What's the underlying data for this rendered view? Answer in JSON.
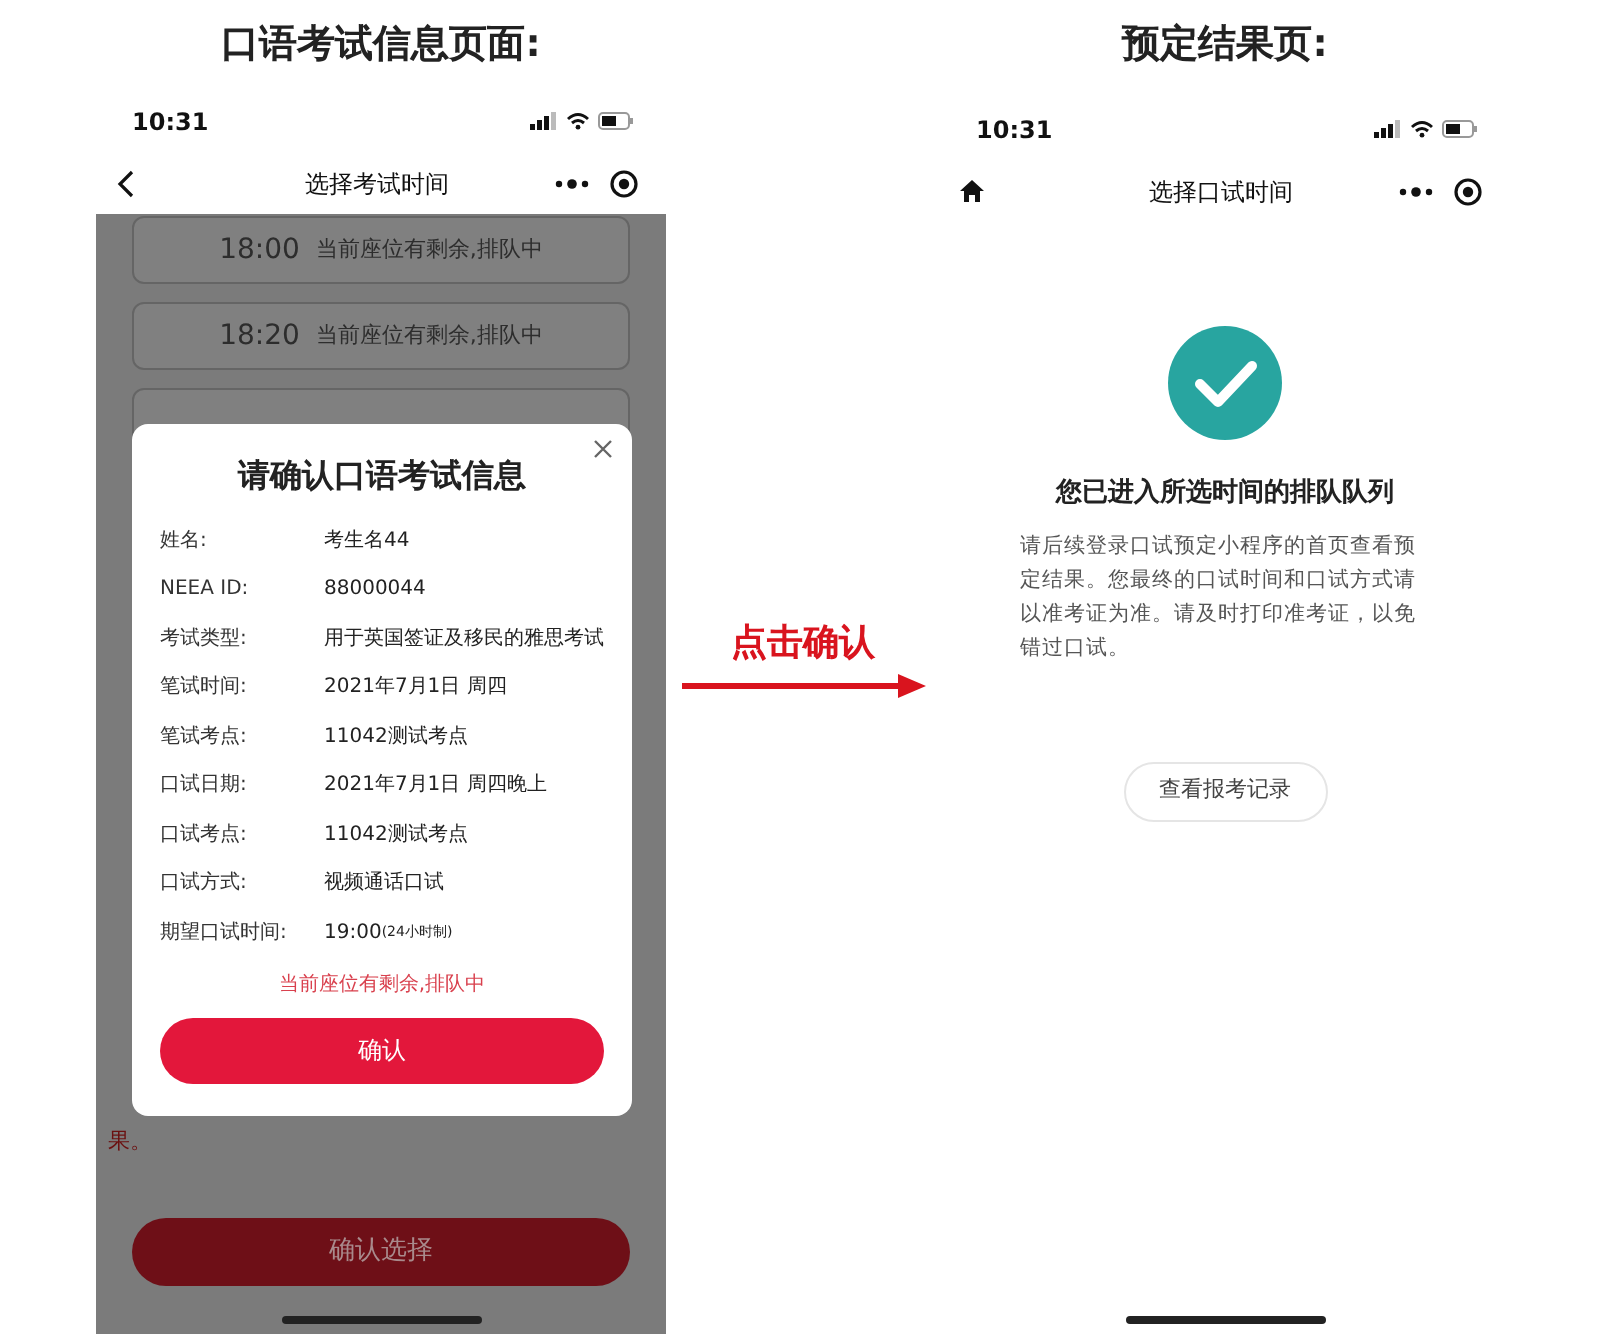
{
  "left_title": "口语考试信息页面:",
  "right_title": "预定结果页:",
  "arrow_label": "点击确认",
  "left_screen": {
    "status_time": "10:31",
    "nav_title": "选择考试时间",
    "slots": [
      {
        "time": "18:00",
        "status": "当前座位有剩余,排队中"
      },
      {
        "time": "18:20",
        "status": "当前座位有剩余,排队中"
      }
    ],
    "background_note": "果。",
    "footer_button": "确认选择",
    "dialog": {
      "title": "请确认口语考试信息",
      "fields": [
        {
          "label": "姓名:",
          "value": "考生名44"
        },
        {
          "label": "NEEA ID:",
          "value": "88000044"
        },
        {
          "label": "考试类型:",
          "value": "用于英国签证及移民的雅思考试"
        },
        {
          "label": "笔试时间:",
          "value": "2021年7月1日 周四"
        },
        {
          "label": "笔试考点:",
          "value": "11042测试考点"
        },
        {
          "label": "口试日期:",
          "value": "2021年7月1日 周四晚上"
        },
        {
          "label": "口试考点:",
          "value": "11042测试考点"
        },
        {
          "label": "口试方式:",
          "value": "视频通话口试"
        },
        {
          "label": "期望口试时间:",
          "value": "19:00",
          "note": "(24小时制)"
        }
      ],
      "status_note": "当前座位有剩余,排队中",
      "confirm_button": "确认"
    }
  },
  "right_screen": {
    "status_time": "10:31",
    "nav_title": "选择口试时间",
    "heading": "您已进入所选时间的排队队列",
    "body": "请后续登录口试预定小程序的首页查看预定结果。您最终的口试时间和口试方式请以准考证为准。请及时打印准考证，以免错过口试。",
    "records_button": "查看报考记录"
  }
}
